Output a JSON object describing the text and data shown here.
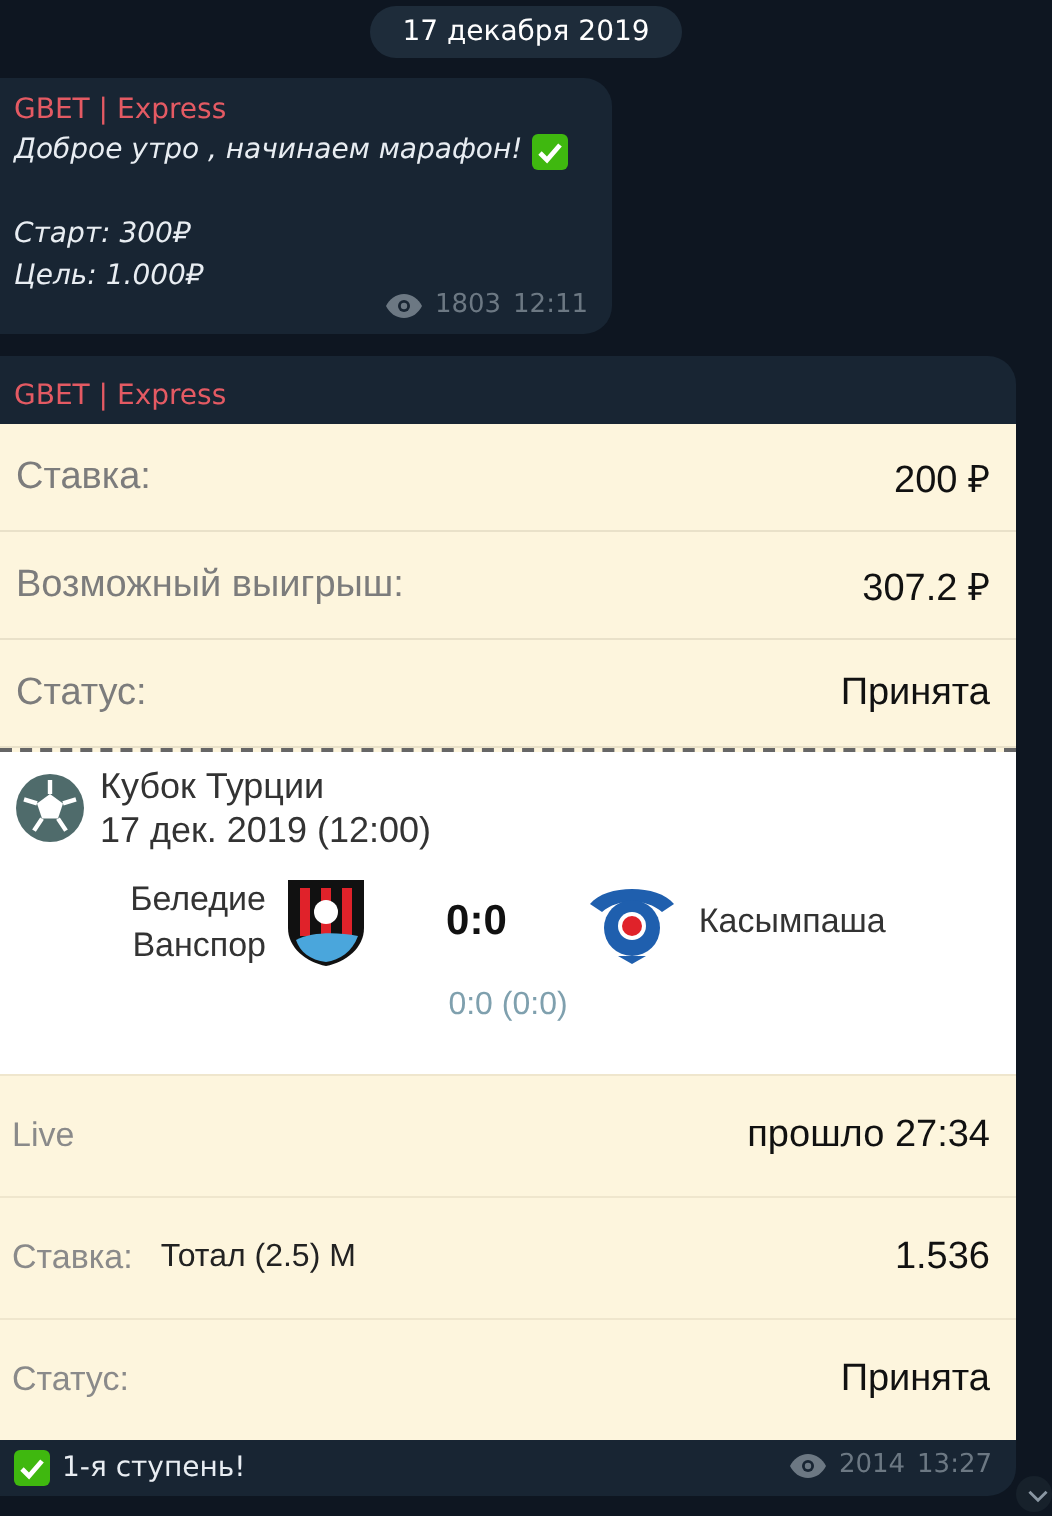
{
  "date_pill": "17 декабря 2019",
  "messages": [
    {
      "sender": "GBET | Express",
      "lines": [
        "Доброе утро , начинаем марафон!",
        "Старт: 300₽",
        "Цель: 1.000₽"
      ],
      "views": "1803",
      "time": "12:11"
    },
    {
      "sender": "GBET | Express",
      "bet_card": {
        "summary_rows": [
          {
            "label": "Ставка:",
            "value": "200 ₽"
          },
          {
            "label": "Возможный выигрыш:",
            "value": "307.2 ₽"
          },
          {
            "label": "Статус:",
            "value": "Принята"
          }
        ],
        "match": {
          "tournament": "Кубок Турции",
          "datetime": "17 дек. 2019 (12:00)",
          "home": "Беледие\nВанспор",
          "score": "0:0",
          "away": "Касымпаша",
          "detail_score": "0:0 (0:0)"
        },
        "detail_rows": [
          {
            "label": "Live",
            "value": "прошло 27:34"
          },
          {
            "label": "Ставка:",
            "bet": "Тотал (2.5) М",
            "value": "1.536"
          },
          {
            "label": "Статус:",
            "value": "Принята"
          }
        ]
      },
      "caption": "1-я ступень!",
      "views": "2014",
      "time": "13:27"
    }
  ]
}
